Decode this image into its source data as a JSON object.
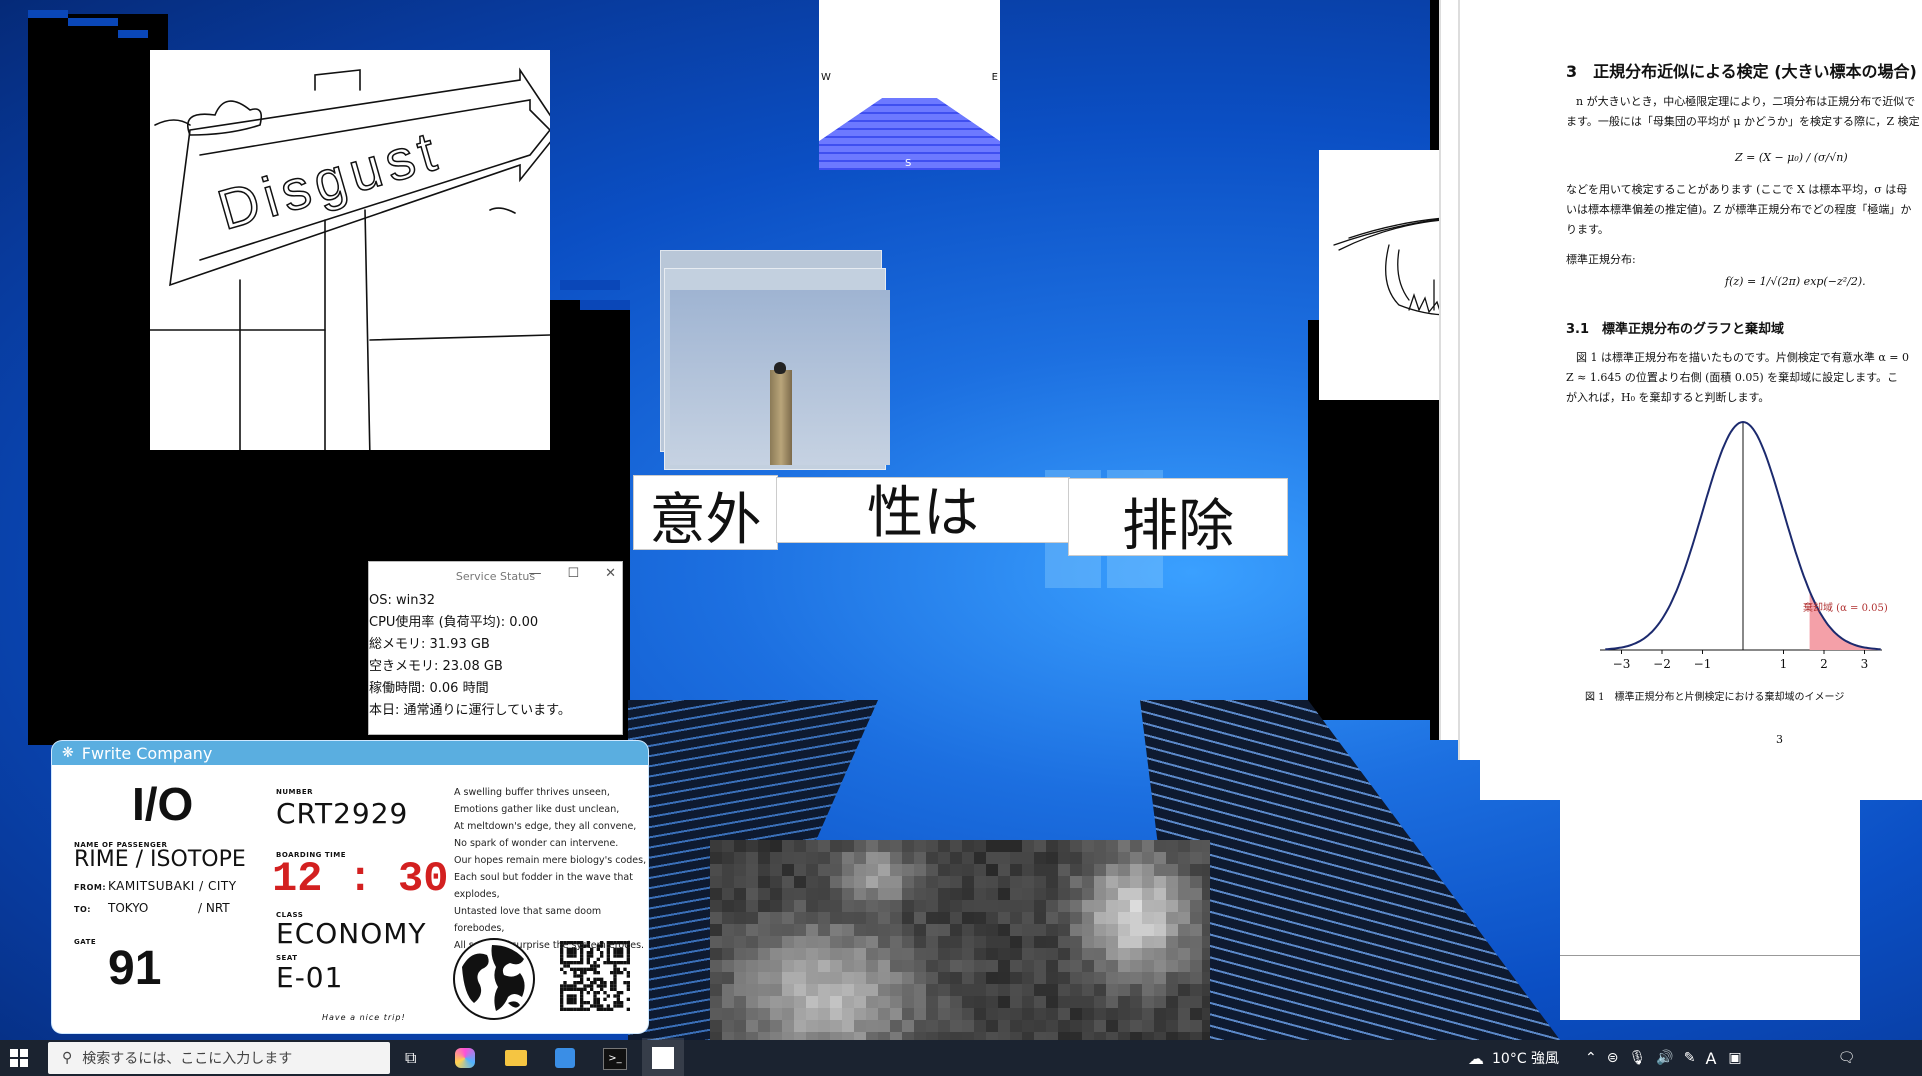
{
  "drawing": {
    "sign_text": "Disgust"
  },
  "compass": {
    "west": "W",
    "east": "E",
    "south": "S"
  },
  "labels": {
    "left": "意外",
    "middle": "性は",
    "right": "排除"
  },
  "status_window": {
    "title": "Service Status",
    "lines": [
      "OS: win32",
      "CPU使用率 (負荷平均): 0.00",
      "総メモリ: 31.93 GB",
      "空きメモリ: 23.08 GB",
      "稼働時間: 0.06 時間",
      "本日: 通常通りに運行しています。"
    ]
  },
  "ticket": {
    "company": "Fwrite Company",
    "code": "I/O",
    "passenger_label": "NAME OF PASSENGER",
    "passenger": "RIME / ISOTOPE",
    "from_label": "FROM:",
    "from": "KAMITSUBAKI / CITY",
    "to_label": "TO:",
    "to_city": "TOKYO",
    "to_station": "/ NRT",
    "gate_label": "GATE",
    "gate": "91",
    "number_label": "NUMBER",
    "number": "CRT2929",
    "boarding_label": "BOARDING TIME",
    "boarding": "12 : 30",
    "class_label": "CLASS",
    "class": "ECONOMY",
    "seat_label": "SEAT",
    "seat": "E-01",
    "footer": "Have a nice trip!",
    "poem": [
      "A swelling buffer thrives unseen,",
      "Emotions gather like dust unclean,",
      "At meltdown's edge, they all convene,",
      "No spark of wonder can intervene.",
      "Our hopes remain mere biology's codes,",
      "Each soul but fodder in the wave that explodes,",
      "Untasted love that same doom forebodes,",
      "All sense of surprise the system erodes."
    ]
  },
  "pdf": {
    "section_title": "3　正規分布近似による検定 (大きい標本の場合)",
    "para1_line1": "n が大きいとき，中心極限定理により，二項分布は正規分布で近似で",
    "para1_line2": "ます。一般には「母集団の平均が μ かどうか」を検定する際に，Z 検定",
    "formula_z": "Z = (X − μ₀) / (σ/√n)",
    "para2_line1": "などを用いて検定することがあります (ここで X は標本平均，σ は母",
    "para2_line2": "いは標本標準偏差の推定値)。Z が標準正規分布でどの程度「極端」か",
    "para2_line3": "ります。",
    "std_normal_label": "標準正規分布:",
    "formula_f": "f(z) = 1/√(2π) exp(−z²/2).",
    "subsection": "3.1　標準正規分布のグラフと棄却域",
    "para3_line1": "図 1 は標準正規分布を描いたものです。片側検定で有意水準 α = 0",
    "para3_line2": "Z ≈ 1.645 の位置より右側 (面積 0.05) を棄却域に設定します。こ",
    "para3_line3": "が入れば，H₀ を棄却すると判断します。",
    "rejection_label": "棄却域 (α = 0.05)",
    "x_ticks": [
      "−3",
      "−2",
      "−1",
      "1",
      "2",
      "3"
    ],
    "caption": "図 1　標準正規分布と片側検定における棄却域のイメージ",
    "page_number": "3"
  },
  "taskbar": {
    "search_placeholder": "検索するには、ここに入力します",
    "weather": "10°C 強風",
    "ime_label": "A"
  },
  "colors": {
    "desktop_blue": "#0b4fc4",
    "ticket_header": "#5aaee0",
    "boarding_red": "#d32020",
    "taskbar": "#1b2330",
    "curve_navy": "#1c2a6e",
    "rejection_pink": "#f4a0a8"
  }
}
